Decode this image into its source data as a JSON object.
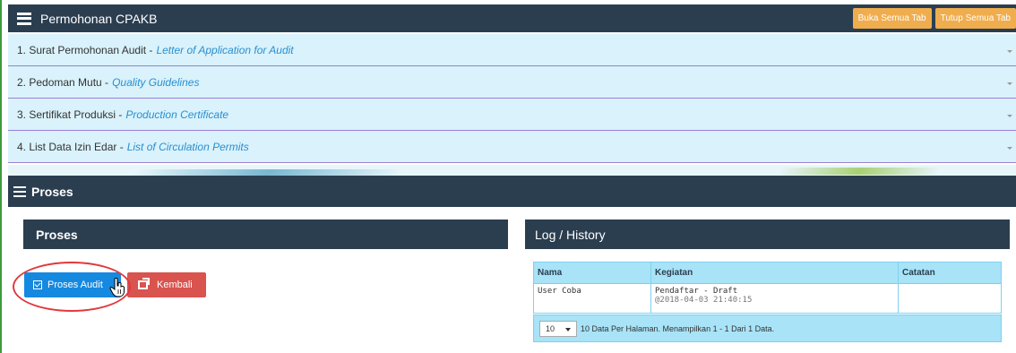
{
  "header": {
    "title": "Permohonan CPAKB",
    "open_all_label": "Buka Semua Tab",
    "close_all_label": "Tutup Semua Tab"
  },
  "accordion": [
    {
      "label": "1. Surat Permohonan Audit - ",
      "en": "Letter of Application for Audit"
    },
    {
      "label": "2. Pedoman Mutu - ",
      "en": "Quality Guidelines"
    },
    {
      "label": "3. Sertifikat Produksi - ",
      "en": "Production Certificate"
    },
    {
      "label": "4. List Data Izin Edar - ",
      "en": "List of Circulation Permits"
    }
  ],
  "proses_section": {
    "title": "Proses"
  },
  "proses_panel": {
    "title": "Proses",
    "audit_label": "Proses Audit",
    "back_label": "Kembali"
  },
  "log_panel": {
    "title": "Log / History",
    "columns": [
      "Nama",
      "Kegiatan",
      "Catatan"
    ],
    "rows": [
      {
        "nama": "User Coba",
        "kegiatan": "Pendaftar - Draft",
        "date": "@2018-04-03 21:40:15",
        "catatan": ""
      }
    ],
    "page_size": "10",
    "footer_text": "10 Data Per Halaman. Menampilkan 1 - 1 Dari 1 Data."
  },
  "colors": {
    "dark_header": "#2b3e50",
    "accordion_bg": "#d9f2fb",
    "orange_button": "#f0ad4e",
    "primary_button": "#1589e0",
    "danger_button": "#d9534f",
    "annotation_circle": "#e0393e"
  }
}
